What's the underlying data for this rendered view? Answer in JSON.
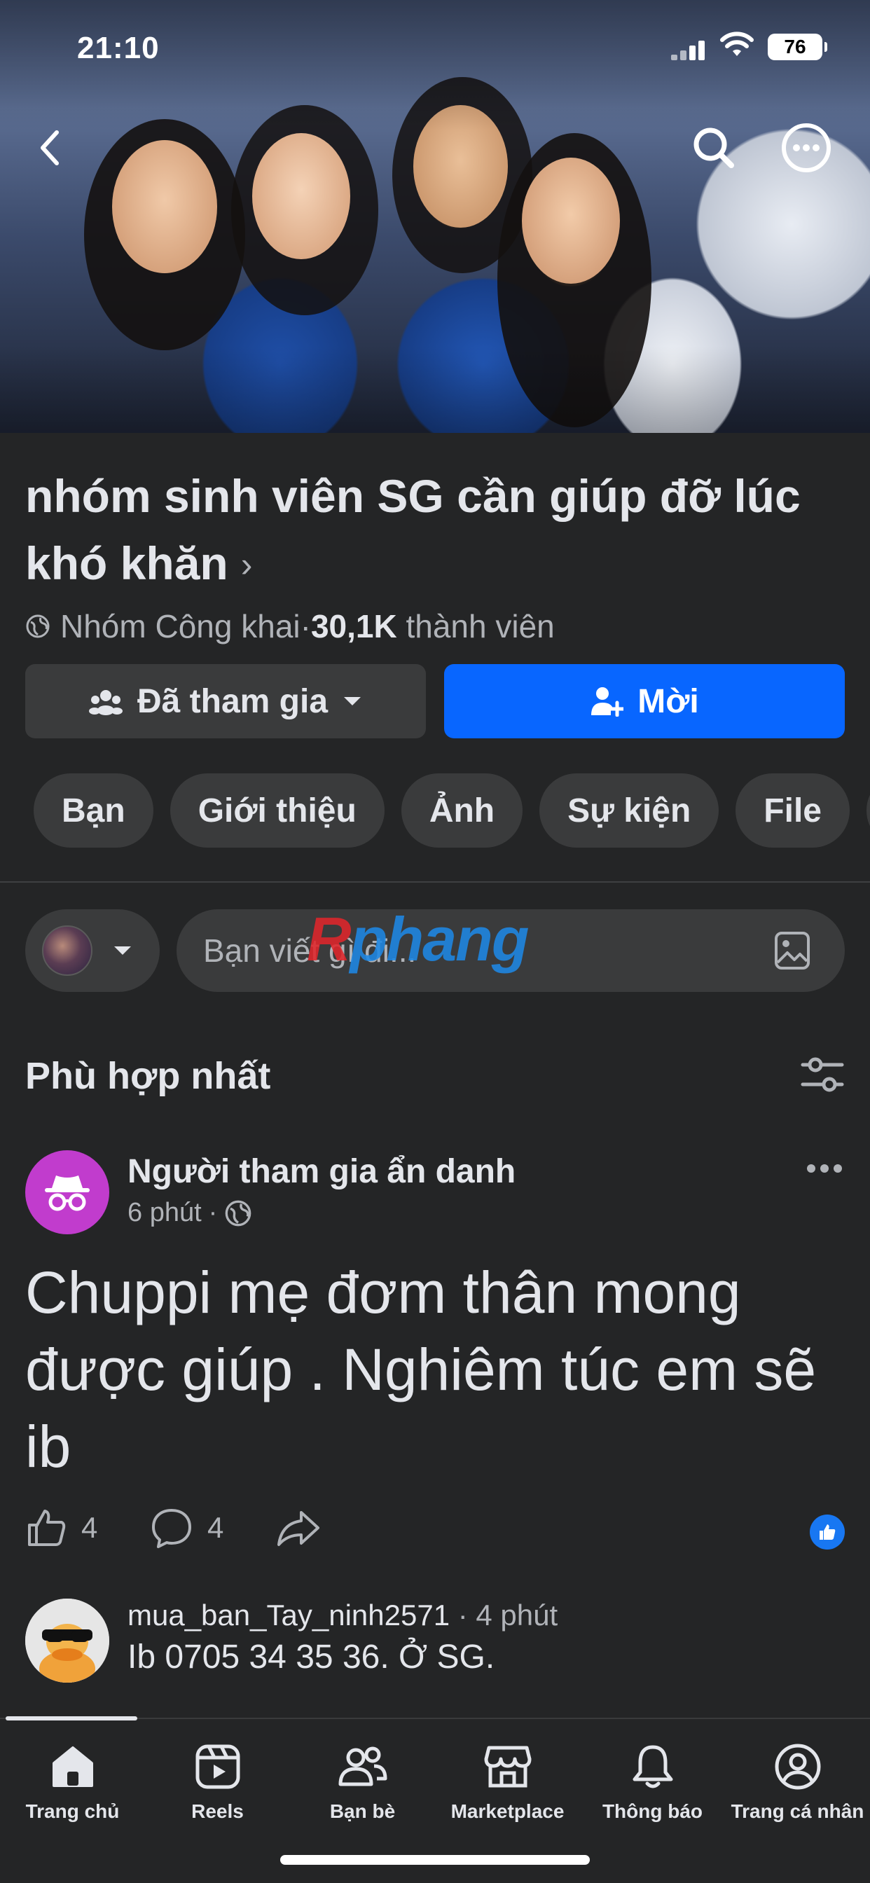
{
  "status_bar": {
    "time": "21:10",
    "battery": "76"
  },
  "group": {
    "title": "nhóm sinh viên SG cần giúp đỡ lúc khó khăn",
    "privacy": "Nhóm Công khai",
    "separator": " · ",
    "member_count": "30,1K",
    "member_label": "thành viên"
  },
  "buttons": {
    "joined": "Đã tham gia",
    "invite": "Mời"
  },
  "chips": [
    "Bạn",
    "Giới thiệu",
    "Ảnh",
    "Sự kiện",
    "File"
  ],
  "composer": {
    "placeholder": "Bạn viết gì đi..."
  },
  "watermark": {
    "part1": "R",
    "part2": "phang"
  },
  "sort": {
    "label": "Phù hợp nhất"
  },
  "post": {
    "author": "Người tham gia ẩn danh",
    "time": "6 phút",
    "dot": "·",
    "body": "Chuppi mẹ đơm thân mong được giúp . Nghiêm túc em sẽ ib",
    "likes": "4",
    "comments": "4"
  },
  "comment": {
    "author": "mua_ban_Tay_ninh2571",
    "time": "· 4 phút",
    "text": "Ib 0705 34 35 36. Ở SG."
  },
  "tabbar": {
    "home": "Trang chủ",
    "reels": "Reels",
    "friends": "Bạn bè",
    "marketplace": "Marketplace",
    "notifications": "Thông báo",
    "profile": "Trang cá nhân"
  },
  "colors": {
    "primary": "#0866ff",
    "background": "#242526",
    "surface": "#3a3b3c",
    "anon_avatar": "#c13ccd"
  }
}
